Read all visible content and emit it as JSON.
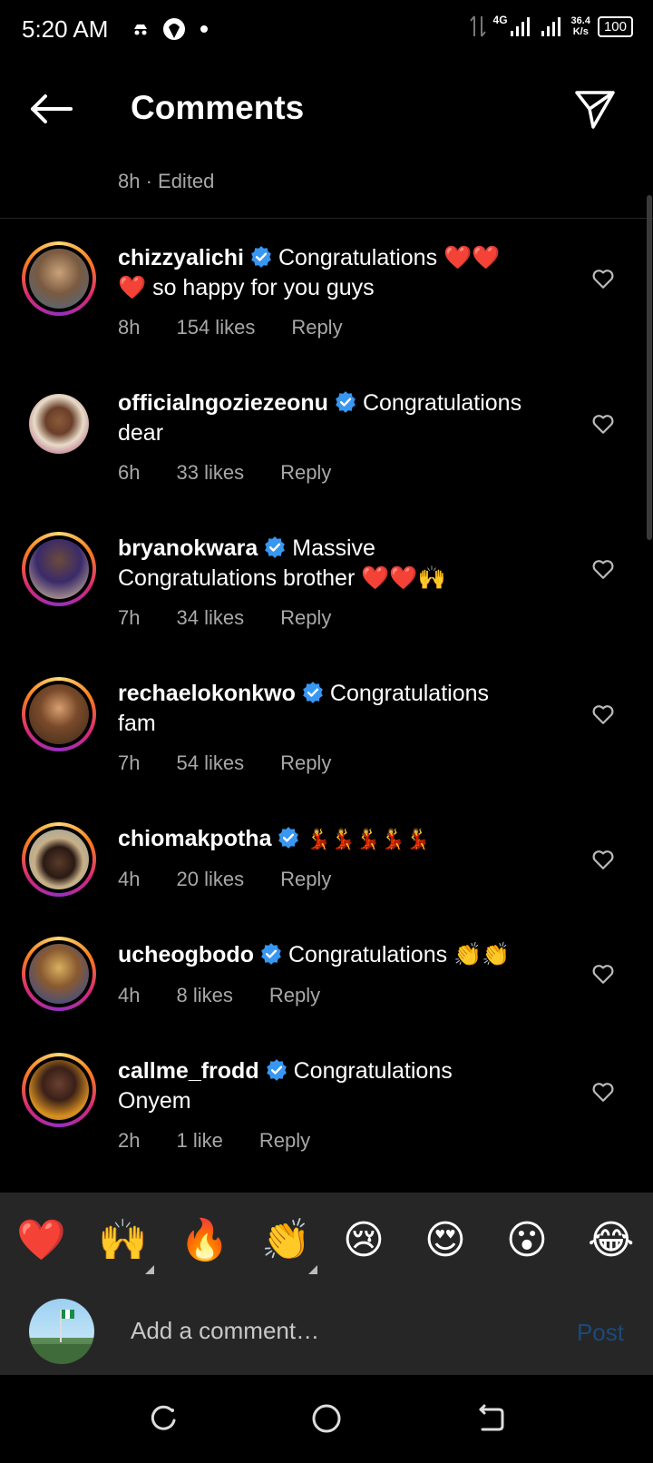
{
  "status_bar": {
    "time": "5:20 AM",
    "network": "4G",
    "speed_value": "36.4",
    "speed_unit": "K/s",
    "battery": "100"
  },
  "header": {
    "title": "Comments"
  },
  "caption_meta": "8h · Edited",
  "comments": [
    {
      "username": "chizzyalichi",
      "text_first": "Congratulations ❤️❤️",
      "text_second": "❤️ so happy for you guys",
      "time": "8h",
      "likes": "154 likes",
      "reply": "Reply"
    },
    {
      "username": "officialngoziezeonu",
      "text_first": "Congratulations",
      "text_second": "dear",
      "time": "6h",
      "likes": "33 likes",
      "reply": "Reply"
    },
    {
      "username": "bryanokwara",
      "text_first": "Massive",
      "text_second": "Congratulations brother ❤️❤️🙌",
      "time": "7h",
      "likes": "34 likes",
      "reply": "Reply"
    },
    {
      "username": "rechaelokonkwo",
      "text_first": "Congratulations",
      "text_second": "fam",
      "time": "7h",
      "likes": "54 likes",
      "reply": "Reply"
    },
    {
      "username": "chiomakpotha",
      "text_first": "💃💃💃💃💃",
      "text_second": "",
      "time": "4h",
      "likes": "20 likes",
      "reply": "Reply"
    },
    {
      "username": "ucheogbodo",
      "text_first": "Congratulations 👏👏",
      "text_second": "",
      "time": "4h",
      "likes": "8 likes",
      "reply": "Reply"
    },
    {
      "username": "callme_frodd",
      "text_first": "Congratulations",
      "text_second": "Onyem",
      "time": "2h",
      "likes": "1 like",
      "reply": "Reply"
    }
  ],
  "emoji_bar": [
    "❤️",
    "🙌",
    "🔥",
    "👏",
    "😢",
    "😍",
    "😮",
    "😂"
  ],
  "comment_input": {
    "placeholder": "Add a comment…",
    "post_label": "Post"
  },
  "colors": {
    "background": "#000000",
    "secondary_text": "#a8a8a8",
    "verified": "#3897f0",
    "post_disabled": "#1a4a7a"
  }
}
